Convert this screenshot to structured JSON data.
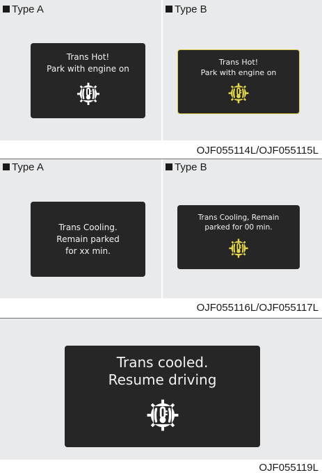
{
  "sections": [
    {
      "type_a_label": "Type A",
      "type_b_label": "Type B",
      "screen_a_text": "Trans Hot!\nPark with engine on",
      "screen_b_text": "Trans Hot!\nPark with engine on",
      "figure_code": "OJF055114L/OJF055115L"
    },
    {
      "type_a_label": "Type A",
      "type_b_label": "Type B",
      "screen_a_text": "Trans Cooling.\nRemain parked\nfor xx min.",
      "screen_b_text": "Trans Cooling, Remain\nparked for 00 min.",
      "figure_code": "OJF055116L/OJF055117L"
    },
    {
      "screen_text": "Trans cooled.\nResume driving",
      "figure_code": "OJF055119L"
    }
  ],
  "icons": {
    "transmission_temp": "transmission-temperature-warning-icon"
  },
  "colors": {
    "panel_background": "#e9eaeb",
    "screen_background": "#262626",
    "screen_text": "#f2f2f2",
    "icon_white": "#ffffff",
    "icon_yellow": "#e6d84e",
    "type_b_highlight_border": "#d8cb43"
  }
}
